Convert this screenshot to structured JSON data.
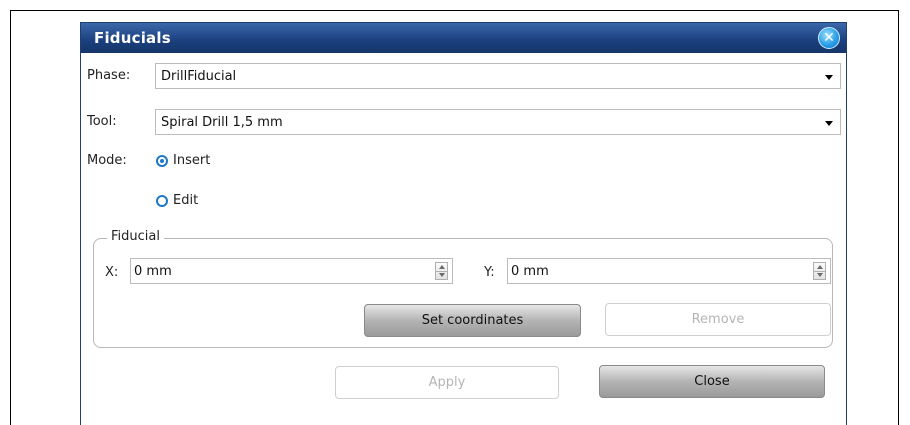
{
  "dialog": {
    "title": "Fiducials",
    "close_icon": "close-x-icon"
  },
  "phase": {
    "label": "Phase:",
    "value": "DrillFiducial"
  },
  "tool": {
    "label": "Tool:",
    "value": "Spiral Drill  1,5 mm"
  },
  "mode": {
    "label": "Mode:",
    "options": [
      {
        "label": "Insert",
        "selected": true
      },
      {
        "label": "Edit",
        "selected": false
      }
    ]
  },
  "fiducial": {
    "group_title": "Fiducial",
    "x_label": "X:",
    "x_value": "0 mm",
    "y_label": "Y:",
    "y_value": "0 mm",
    "set_coordinates_label": "Set coordinates",
    "remove_label": "Remove"
  },
  "footer": {
    "apply_label": "Apply",
    "close_label": "Close"
  },
  "colors": {
    "titlebar": "#1b3f7d",
    "radio_accent": "#1e78c8"
  }
}
